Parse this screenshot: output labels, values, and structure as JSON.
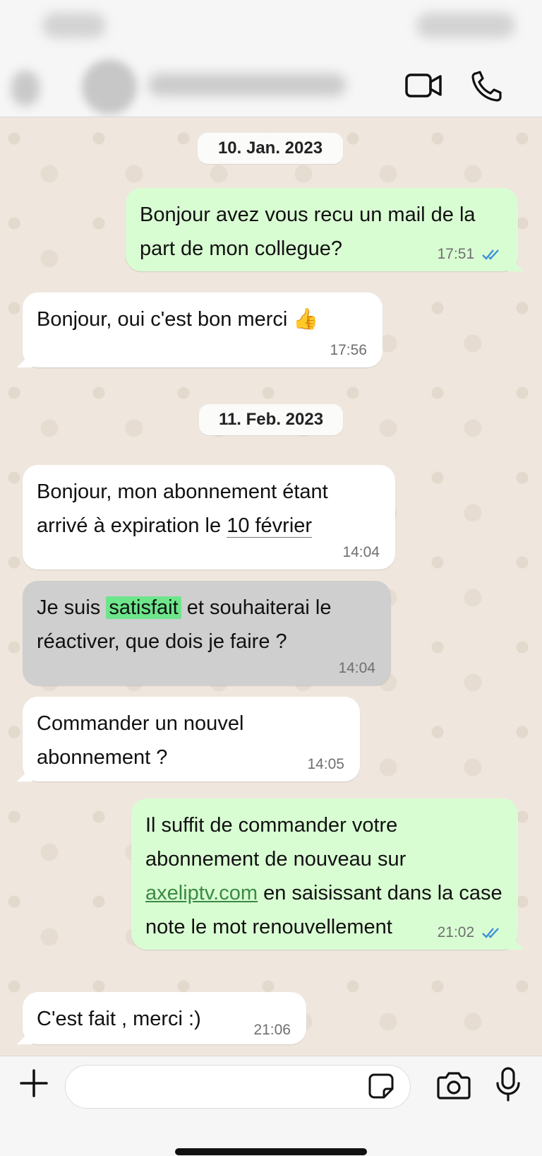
{
  "chat": {
    "dates": [
      "10. Jan. 2023",
      "11. Feb. 2023"
    ],
    "messages": [
      {
        "dir": "out",
        "text": "Bonjour avez vous recu un mail de la part de mon collegue?",
        "time": "17:51",
        "read": true
      },
      {
        "dir": "in",
        "text": "Bonjour, oui c'est bon merci 👍",
        "time": "17:56"
      },
      {
        "dir": "in",
        "text_before": "Bonjour, mon abonnement étant arrivé à expiration le ",
        "date_link": "10 février",
        "time": "14:04"
      },
      {
        "dir": "in",
        "highlighted": true,
        "text_before": "Je suis ",
        "highlight": "satisfait",
        "text_after": " et souhaiterai le réactiver, que dois je faire ?",
        "time": "14:04"
      },
      {
        "dir": "in",
        "text": "Commander un nouvel abonnement ?",
        "time": "14:05"
      },
      {
        "dir": "out",
        "text_before": "Il suffit de commander votre abonnement de nouveau sur ",
        "link": "axeliptv.com",
        "text_after": " en saisissant dans la case note le mot renouvellement",
        "time": "21:02",
        "read": true
      },
      {
        "dir": "in",
        "text": "C'est fait , merci :)",
        "time": "21:06"
      }
    ]
  },
  "icons": {
    "header": [
      "video-call-icon",
      "phone-icon"
    ],
    "composer": [
      "plus-icon",
      "sticker-icon",
      "camera-icon",
      "microphone-icon"
    ]
  },
  "composer": {
    "placeholder": "",
    "value": ""
  },
  "colors": {
    "outgoing": "#d9fdd3",
    "incoming": "#ffffff",
    "read_ticks": "#3b8fd9",
    "highlight": "#6ee58b"
  }
}
